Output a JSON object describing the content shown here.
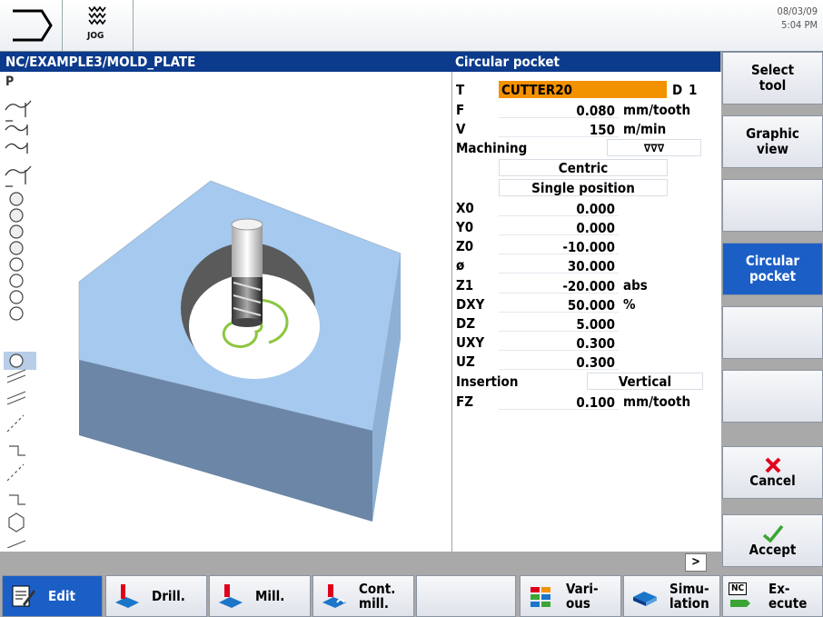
{
  "header": {
    "mode_label": "JOG",
    "date": "08/03/09",
    "time": "5:04 PM",
    "program_path": "NC/EXAMPLE3/MOLD_PLATE",
    "form_title": "Circular pocket"
  },
  "left_strip": {
    "top_label": "P"
  },
  "form": {
    "rows": [
      {
        "label": "T",
        "value": "CUTTER20",
        "extra_label": "D",
        "extra_value": "1"
      },
      {
        "label": "F",
        "value": "0.080",
        "unit": "mm/tooth"
      },
      {
        "label": "V",
        "value": "150",
        "unit": "m/min"
      },
      {
        "label": "Machining",
        "value": "∇∇∇"
      },
      {
        "value": "Centric"
      },
      {
        "value": "Single position"
      },
      {
        "label": "X0",
        "value": "0.000"
      },
      {
        "label": "Y0",
        "value": "0.000"
      },
      {
        "label": "Z0",
        "value": "-10.000"
      },
      {
        "label": "ø",
        "value": "30.000"
      },
      {
        "label": "Z1",
        "value": "-20.000",
        "unit": "abs"
      },
      {
        "label": "DXY",
        "value": "50.000",
        "unit": "%"
      },
      {
        "label": "DZ",
        "value": "5.000"
      },
      {
        "label": "UXY",
        "value": "0.300"
      },
      {
        "label": "UZ",
        "value": "0.300"
      },
      {
        "label": "Insertion",
        "value": "Vertical"
      },
      {
        "label": "FZ",
        "value": "0.100",
        "unit": "mm/tooth"
      }
    ]
  },
  "status": {
    "arrow": ">"
  },
  "softkeys": {
    "select_tool_1": "Select",
    "select_tool_2": "tool",
    "graphic_view_1": "Graphic",
    "graphic_view_2": "view",
    "circular_pocket_1": "Circular",
    "circular_pocket_2": "pocket",
    "cancel": "Cancel",
    "accept": "Accept"
  },
  "hkeys": {
    "edit": "Edit",
    "drill": "Drill.",
    "mill": "Mill.",
    "cont_mill_1": "Cont.",
    "cont_mill_2": "mill.",
    "various_1": "Vari-",
    "various_2": "ous",
    "simulation_1": "Simu-",
    "simulation_2": "lation",
    "execute_badge": "NC",
    "execute_1": "Ex-",
    "execute_2": "ecute"
  },
  "colors": {
    "header_blue": "#0c3a8c",
    "active_blue": "#1b5fc6",
    "tool_highlight": "#f39200",
    "cancel_red": "#e0001b",
    "accept_green": "#3aa535",
    "toolpath_green": "#8cc63f"
  }
}
